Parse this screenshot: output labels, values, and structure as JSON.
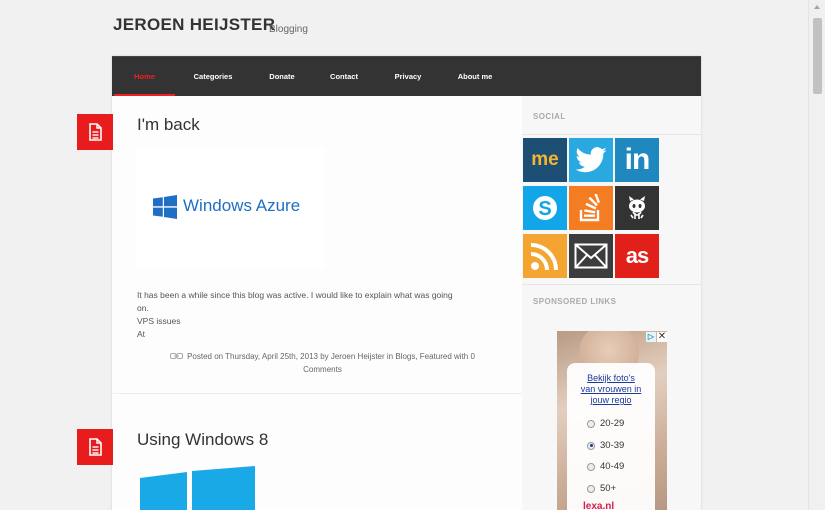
{
  "header": {
    "title": "JEROEN HEIJSTER",
    "tagline": "Blogging"
  },
  "nav": {
    "items": [
      {
        "label": "Home",
        "active": true
      },
      {
        "label": "Categories"
      },
      {
        "label": "Donate"
      },
      {
        "label": "Contact"
      },
      {
        "label": "Privacy"
      },
      {
        "label": "About me"
      }
    ]
  },
  "posts": [
    {
      "title": "I'm back",
      "image_text": "Windows Azure",
      "excerpt": [
        "It has been a while since this blog was active. I would like to explain what was going",
        "on.",
        "VPS issues",
        "At"
      ],
      "meta_line1": "Posted on Thursday, April 25th, 2013 by Jeroen Heijster in Blogs, Featured with 0",
      "meta_line2": "Comments"
    },
    {
      "title": "Using Windows 8"
    }
  ],
  "sidebar": {
    "social_title": "SOCIAL",
    "social": [
      {
        "name": "me",
        "color": "#1c4f73"
      },
      {
        "name": "twitter",
        "color": "#2aa9e0"
      },
      {
        "name": "linkedin",
        "color": "#1f88be"
      },
      {
        "name": "skype",
        "color": "#12a5e8"
      },
      {
        "name": "stackoverflow",
        "color": "#f47c22"
      },
      {
        "name": "github",
        "color": "#333333"
      },
      {
        "name": "rss",
        "color": "#f4a431"
      },
      {
        "name": "email",
        "color": "#3c3c3c"
      },
      {
        "name": "lastfm",
        "color": "#e02019"
      }
    ],
    "social_me_label": "me",
    "sponsored_title": "SPONSORED LINKS",
    "ad": {
      "headline_1": "Bekijk foto's",
      "headline_2": "van vrouwen in",
      "headline_3": "jouw regio",
      "options": [
        "20-29",
        "30-39",
        "40-49",
        "50+"
      ],
      "selected": "30-39",
      "brand": "lexa.nl"
    }
  },
  "colors": {
    "accent": "#e81c1c",
    "nav_bg": "#333333"
  }
}
